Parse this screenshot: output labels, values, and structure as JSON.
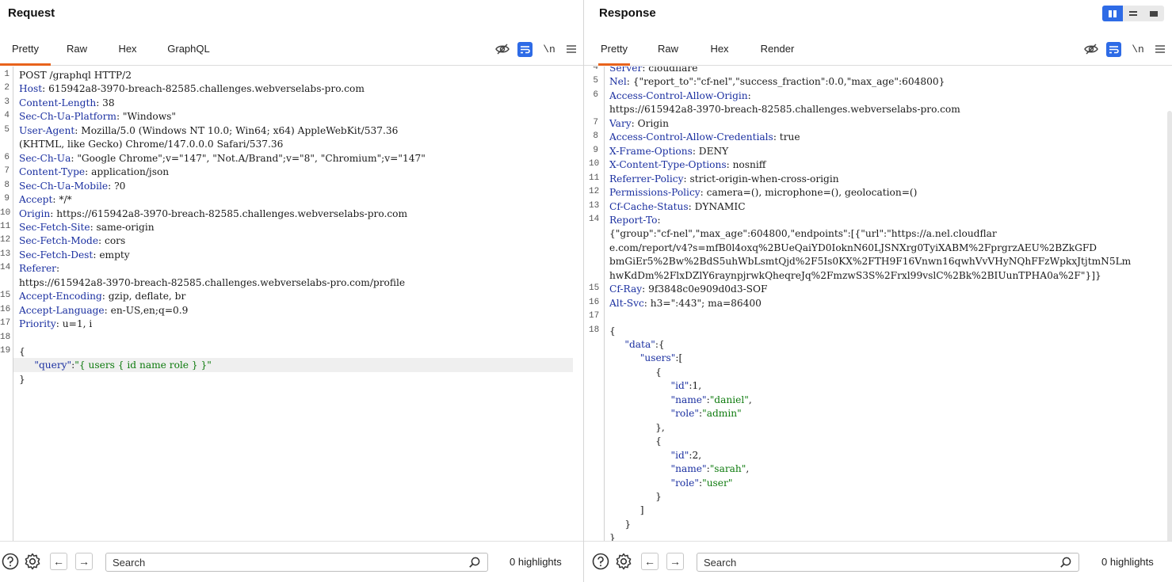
{
  "request": {
    "title": "Request",
    "tabs": [
      "Pretty",
      "Raw",
      "Hex",
      "GraphQL"
    ],
    "active_tab": 0,
    "newline_label": "\\n",
    "lines": [
      {
        "n": "1",
        "parts": [
          {
            "t": "POST /graphql HTTP/2",
            "c": ""
          }
        ]
      },
      {
        "n": "2",
        "parts": [
          {
            "t": "Host",
            "c": "hk"
          },
          {
            "t": ": 615942a8-3970-breach-82585.challenges.webverselabs-pro.com",
            "c": ""
          }
        ]
      },
      {
        "n": "3",
        "parts": [
          {
            "t": "Content-Length",
            "c": "hk"
          },
          {
            "t": ": 38",
            "c": ""
          }
        ]
      },
      {
        "n": "4",
        "parts": [
          {
            "t": "Sec-Ch-Ua-Platform",
            "c": "hk"
          },
          {
            "t": ": \"Windows\"",
            "c": ""
          }
        ]
      },
      {
        "n": "5",
        "parts": [
          {
            "t": "User-Agent",
            "c": "hk"
          },
          {
            "t": ": Mozilla/5.0 (Windows NT 10.0; Win64; x64) AppleWebKit/537.36",
            "c": ""
          }
        ]
      },
      {
        "n": "",
        "parts": [
          {
            "t": "(KHTML, like Gecko) Chrome/147.0.0.0 Safari/537.36",
            "c": ""
          }
        ]
      },
      {
        "n": "6",
        "parts": [
          {
            "t": "Sec-Ch-Ua",
            "c": "hk"
          },
          {
            "t": ": \"Google Chrome\";v=\"147\", \"Not.A/Brand\";v=\"8\", \"Chromium\";v=\"147\"",
            "c": ""
          }
        ]
      },
      {
        "n": "7",
        "parts": [
          {
            "t": "Content-Type",
            "c": "hk"
          },
          {
            "t": ": application/json",
            "c": ""
          }
        ]
      },
      {
        "n": "8",
        "parts": [
          {
            "t": "Sec-Ch-Ua-Mobile",
            "c": "hk"
          },
          {
            "t": ": ?0",
            "c": ""
          }
        ]
      },
      {
        "n": "9",
        "parts": [
          {
            "t": "Accept",
            "c": "hk"
          },
          {
            "t": ": */*",
            "c": ""
          }
        ]
      },
      {
        "n": "10",
        "parts": [
          {
            "t": "Origin",
            "c": "hk"
          },
          {
            "t": ": https://615942a8-3970-breach-82585.challenges.webverselabs-pro.com",
            "c": ""
          }
        ]
      },
      {
        "n": "11",
        "parts": [
          {
            "t": "Sec-Fetch-Site",
            "c": "hk"
          },
          {
            "t": ": same-origin",
            "c": ""
          }
        ]
      },
      {
        "n": "12",
        "parts": [
          {
            "t": "Sec-Fetch-Mode",
            "c": "hk"
          },
          {
            "t": ": cors",
            "c": ""
          }
        ]
      },
      {
        "n": "13",
        "parts": [
          {
            "t": "Sec-Fetch-Dest",
            "c": "hk"
          },
          {
            "t": ": empty",
            "c": ""
          }
        ]
      },
      {
        "n": "14",
        "parts": [
          {
            "t": "Referer",
            "c": "hk"
          },
          {
            "t": ":",
            "c": ""
          }
        ]
      },
      {
        "n": "",
        "parts": [
          {
            "t": "https://615942a8-3970-breach-82585.challenges.webverselabs-pro.com/profile",
            "c": ""
          }
        ]
      },
      {
        "n": "15",
        "parts": [
          {
            "t": "Accept-Encoding",
            "c": "hk"
          },
          {
            "t": ": gzip, deflate, br",
            "c": ""
          }
        ]
      },
      {
        "n": "16",
        "parts": [
          {
            "t": "Accept-Language",
            "c": "hk"
          },
          {
            "t": ": en-US,en;q=0.9",
            "c": ""
          }
        ]
      },
      {
        "n": "17",
        "parts": [
          {
            "t": "Priority",
            "c": "hk"
          },
          {
            "t": ": u=1, i",
            "c": ""
          }
        ]
      },
      {
        "n": "18",
        "parts": [
          {
            "t": "",
            "c": ""
          }
        ]
      },
      {
        "n": "19",
        "parts": [
          {
            "t": "{",
            "c": ""
          }
        ]
      },
      {
        "n": "",
        "hl": true,
        "parts": [
          {
            "t": "     ",
            "c": ""
          },
          {
            "t": "\"query\"",
            "c": "jk"
          },
          {
            "t": ":",
            "c": ""
          },
          {
            "t": "\"{ users { id name role } }\"",
            "c": "js"
          }
        ]
      },
      {
        "n": "",
        "parts": [
          {
            "t": "}",
            "c": ""
          }
        ]
      }
    ],
    "search_placeholder": "Search",
    "highlights": "0 highlights"
  },
  "response": {
    "title": "Response",
    "tabs": [
      "Pretty",
      "Raw",
      "Hex",
      "Render"
    ],
    "active_tab": 0,
    "newline_label": "\\n",
    "lines": [
      {
        "n": "4",
        "parts": [
          {
            "t": "Server",
            "c": "hk"
          },
          {
            "t": ": cloudflare",
            "c": ""
          }
        ]
      },
      {
        "n": "5",
        "parts": [
          {
            "t": "Nel",
            "c": "hk"
          },
          {
            "t": ": {\"report_to\":\"cf-nel\",\"success_fraction\":0.0,\"max_age\":604800}",
            "c": ""
          }
        ]
      },
      {
        "n": "6",
        "parts": [
          {
            "t": "Access-Control-Allow-Origin",
            "c": "hk"
          },
          {
            "t": ":",
            "c": ""
          }
        ]
      },
      {
        "n": "",
        "parts": [
          {
            "t": "https://615942a8-3970-breach-82585.challenges.webverselabs-pro.com",
            "c": ""
          }
        ]
      },
      {
        "n": "7",
        "parts": [
          {
            "t": "Vary",
            "c": "hk"
          },
          {
            "t": ": Origin",
            "c": ""
          }
        ]
      },
      {
        "n": "8",
        "parts": [
          {
            "t": "Access-Control-Allow-Credentials",
            "c": "hk"
          },
          {
            "t": ": true",
            "c": ""
          }
        ]
      },
      {
        "n": "9",
        "parts": [
          {
            "t": "X-Frame-Options",
            "c": "hk"
          },
          {
            "t": ": DENY",
            "c": ""
          }
        ]
      },
      {
        "n": "10",
        "parts": [
          {
            "t": "X-Content-Type-Options",
            "c": "hk"
          },
          {
            "t": ": nosniff",
            "c": ""
          }
        ]
      },
      {
        "n": "11",
        "parts": [
          {
            "t": "Referrer-Policy",
            "c": "hk"
          },
          {
            "t": ": strict-origin-when-cross-origin",
            "c": ""
          }
        ]
      },
      {
        "n": "12",
        "parts": [
          {
            "t": "Permissions-Policy",
            "c": "hk"
          },
          {
            "t": ": camera=(), microphone=(), geolocation=()",
            "c": ""
          }
        ]
      },
      {
        "n": "13",
        "parts": [
          {
            "t": "Cf-Cache-Status",
            "c": "hk"
          },
          {
            "t": ": DYNAMIC",
            "c": ""
          }
        ]
      },
      {
        "n": "14",
        "parts": [
          {
            "t": "Report-To",
            "c": "hk"
          },
          {
            "t": ":",
            "c": ""
          }
        ]
      },
      {
        "n": "",
        "parts": [
          {
            "t": "{\"group\":\"cf-nel\",\"max_age\":604800,\"endpoints\":[{\"url\":\"https://a.nel.cloudflar",
            "c": ""
          }
        ]
      },
      {
        "n": "",
        "parts": [
          {
            "t": "e.com/report/v4?s=mfB0l4oxq%2BUeQaiYD0IoknN60LJSNXrg0TyiXABM%2FprgrzAEU%2BZkGFD",
            "c": ""
          }
        ]
      },
      {
        "n": "",
        "parts": [
          {
            "t": "bmGiEr5%2Bw%2BdS5uhWbLsmtQjd%2F5Is0KX%2FTH9F16Vnwn16qwhVvVHyNQhFFzWpkxJtjtmN5Lm",
            "c": ""
          }
        ]
      },
      {
        "n": "",
        "parts": [
          {
            "t": "hwKdDm%2FlxDZlY6raynpjrwkQheqreJq%2FmzwS3S%2Frxl99vslC%2Bk%2BIUunTPHA0a%2F\"}]}",
            "c": ""
          }
        ]
      },
      {
        "n": "15",
        "parts": [
          {
            "t": "Cf-Ray",
            "c": "hk"
          },
          {
            "t": ": 9f3848c0e909d0d3-SOF",
            "c": ""
          }
        ]
      },
      {
        "n": "16",
        "parts": [
          {
            "t": "Alt-Svc",
            "c": "hk"
          },
          {
            "t": ": h3=\":443\"; ma=86400",
            "c": ""
          }
        ]
      },
      {
        "n": "17",
        "parts": [
          {
            "t": "",
            "c": ""
          }
        ]
      },
      {
        "n": "18",
        "parts": [
          {
            "t": "{",
            "c": ""
          }
        ]
      },
      {
        "n": "",
        "parts": [
          {
            "t": "     ",
            "c": ""
          },
          {
            "t": "\"data\"",
            "c": "jk"
          },
          {
            "t": ":{",
            "c": ""
          }
        ]
      },
      {
        "n": "",
        "parts": [
          {
            "t": "          ",
            "c": ""
          },
          {
            "t": "\"users\"",
            "c": "jk"
          },
          {
            "t": ":[",
            "c": ""
          }
        ]
      },
      {
        "n": "",
        "parts": [
          {
            "t": "               {",
            "c": ""
          }
        ]
      },
      {
        "n": "",
        "parts": [
          {
            "t": "                    ",
            "c": ""
          },
          {
            "t": "\"id\"",
            "c": "jk"
          },
          {
            "t": ":1,",
            "c": ""
          }
        ]
      },
      {
        "n": "",
        "parts": [
          {
            "t": "                    ",
            "c": ""
          },
          {
            "t": "\"name\"",
            "c": "jk"
          },
          {
            "t": ":",
            "c": ""
          },
          {
            "t": "\"daniel\"",
            "c": "js"
          },
          {
            "t": ",",
            "c": ""
          }
        ]
      },
      {
        "n": "",
        "parts": [
          {
            "t": "                    ",
            "c": ""
          },
          {
            "t": "\"role\"",
            "c": "jk"
          },
          {
            "t": ":",
            "c": ""
          },
          {
            "t": "\"admin\"",
            "c": "js"
          }
        ]
      },
      {
        "n": "",
        "parts": [
          {
            "t": "               },",
            "c": ""
          }
        ]
      },
      {
        "n": "",
        "parts": [
          {
            "t": "               {",
            "c": ""
          }
        ]
      },
      {
        "n": "",
        "parts": [
          {
            "t": "                    ",
            "c": ""
          },
          {
            "t": "\"id\"",
            "c": "jk"
          },
          {
            "t": ":2,",
            "c": ""
          }
        ]
      },
      {
        "n": "",
        "parts": [
          {
            "t": "                    ",
            "c": ""
          },
          {
            "t": "\"name\"",
            "c": "jk"
          },
          {
            "t": ":",
            "c": ""
          },
          {
            "t": "\"sarah\"",
            "c": "js"
          },
          {
            "t": ",",
            "c": ""
          }
        ]
      },
      {
        "n": "",
        "parts": [
          {
            "t": "                    ",
            "c": ""
          },
          {
            "t": "\"role\"",
            "c": "jk"
          },
          {
            "t": ":",
            "c": ""
          },
          {
            "t": "\"user\"",
            "c": "js"
          }
        ]
      },
      {
        "n": "",
        "parts": [
          {
            "t": "               }",
            "c": ""
          }
        ]
      },
      {
        "n": "",
        "parts": [
          {
            "t": "          ]",
            "c": ""
          }
        ]
      },
      {
        "n": "",
        "parts": [
          {
            "t": "     }",
            "c": ""
          }
        ]
      },
      {
        "n": "",
        "parts": [
          {
            "t": "}",
            "c": ""
          }
        ]
      }
    ],
    "search_placeholder": "Search",
    "highlights": "0 highlights"
  },
  "colors": {
    "accent_tab": "#e8631c",
    "active_button": "#2e6be6",
    "header_key": "#1a2fa0",
    "json_string": "#0c7a0c"
  },
  "icons": [
    "hide-nonprinting-icon",
    "wrap-lines-icon",
    "menu-icon",
    "help-icon",
    "settings-icon",
    "arrow-left-icon",
    "arrow-right-icon",
    "search-icon"
  ]
}
